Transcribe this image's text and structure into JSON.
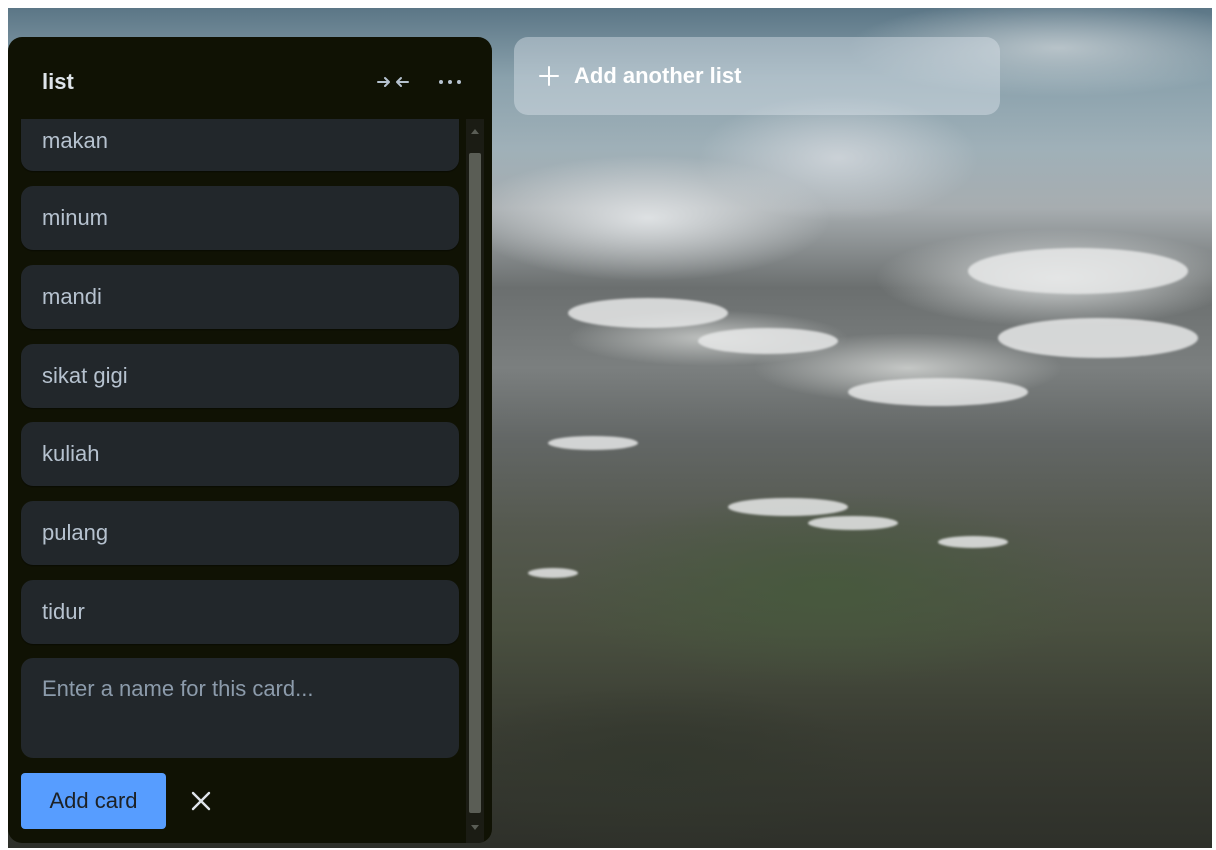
{
  "colors": {
    "list_background": "#101204",
    "card_background": "#22272b",
    "card_text": "#b6c2cf",
    "title_text": "#dee4ea",
    "primary_button": "#579dff",
    "primary_button_text": "#1d2125",
    "placeholder_text": "#8c9bab"
  },
  "list": {
    "title": "list",
    "header_icons": [
      "collapse-icon",
      "more-icon"
    ],
    "cards": [
      {
        "label": "makan"
      },
      {
        "label": "minum"
      },
      {
        "label": "mandi"
      },
      {
        "label": "sikat gigi"
      },
      {
        "label": "kuliah"
      },
      {
        "label": "pulang"
      },
      {
        "label": "tidur"
      }
    ],
    "composer": {
      "placeholder": "Enter a name for this card...",
      "value": ""
    },
    "add_card_label": "Add card",
    "close_icon": "close-icon"
  },
  "add_list": {
    "icon": "plus-icon",
    "label": "Add another list"
  }
}
